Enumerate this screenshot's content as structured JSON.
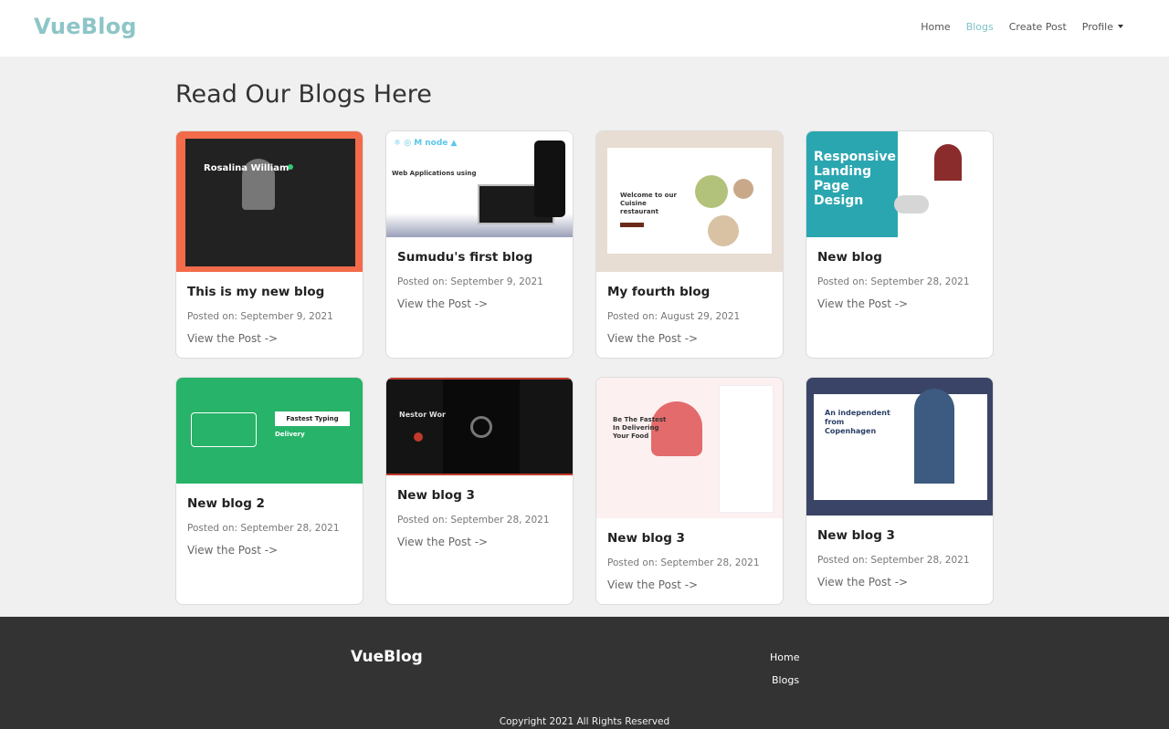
{
  "navbar": {
    "brand": "VueBlog",
    "links": [
      "Home",
      "Blogs",
      "Create Post",
      "Profile"
    ],
    "active": "Blogs",
    "brand_color": "#8ec5c7"
  },
  "page": {
    "title": "Read Our Blogs Here"
  },
  "posts": [
    {
      "title": "This is my new blog",
      "date": "Posted on: September 9, 2021",
      "link": "View the Post ->",
      "thumb_text": "Rosalina William"
    },
    {
      "title": "Sumudu's first blog",
      "date": "Posted on: September 9, 2021",
      "link": "View the Post ->",
      "thumb_text": "Web Applications using"
    },
    {
      "title": "My fourth blog",
      "date": "Posted on: August 29, 2021",
      "link": "View the Post ->",
      "thumb_text": "Welcome to our Cuisine restaurant"
    },
    {
      "title": "New blog",
      "date": "Posted on: September 28, 2021",
      "link": "View the Post ->",
      "thumb_text": "Responsive Landing Page Design"
    },
    {
      "title": "New blog 2",
      "date": "Posted on: September 28, 2021",
      "link": "View the Post ->",
      "thumb_text": "Fastest Typing"
    },
    {
      "title": "New blog 3",
      "date": "Posted on: September 28, 2021",
      "link": "View the Post ->",
      "thumb_text": "Nestor Wor"
    },
    {
      "title": "New blog 3",
      "date": "Posted on: September 28, 2021",
      "link": "View the Post ->",
      "thumb_text": "Be The Fastest In Delivering Your Food"
    },
    {
      "title": "New blog 3",
      "date": "Posted on: September 28, 2021",
      "link": "View the Post ->",
      "thumb_text": "An independent from Copenhagen"
    }
  ],
  "footer": {
    "brand": "VueBlog",
    "links": [
      "Home",
      "Blogs"
    ],
    "copyright": "Copyright 2021 All Rights Reserved"
  }
}
